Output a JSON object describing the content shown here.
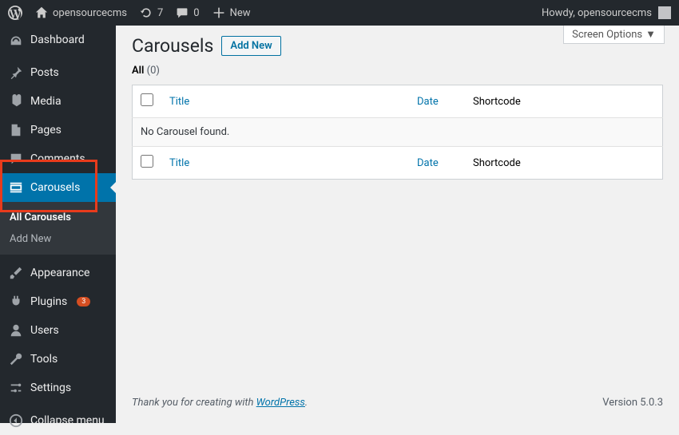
{
  "adminbar": {
    "site_name": "opensourcecms",
    "udpates_count": "7",
    "comments_count": "0",
    "new_label": "New",
    "howdy": "Howdy, opensourcecms"
  },
  "sidebar": {
    "items": [
      {
        "label": "Dashboard"
      },
      {
        "label": "Posts"
      },
      {
        "label": "Media"
      },
      {
        "label": "Pages"
      },
      {
        "label": "Comments"
      },
      {
        "label": "Carousels"
      },
      {
        "label": "Appearance"
      },
      {
        "label": "Plugins"
      },
      {
        "label": "Users"
      },
      {
        "label": "Tools"
      },
      {
        "label": "Settings"
      },
      {
        "label": "Collapse menu"
      }
    ],
    "plugins_badge": "3",
    "submenu": {
      "all": "All Carousels",
      "add": "Add New"
    }
  },
  "page": {
    "title": "Carousels",
    "add_new": "Add New",
    "screen_options": "Screen Options",
    "filter_all": "All",
    "filter_count": "(0)"
  },
  "table": {
    "col_title": "Title",
    "col_date": "Date",
    "col_shortcode": "Shortcode",
    "empty": "No Carousel found."
  },
  "footer": {
    "thank": "Thank you for creating with ",
    "wp": "WordPress",
    "version": "Version 5.0.3"
  }
}
